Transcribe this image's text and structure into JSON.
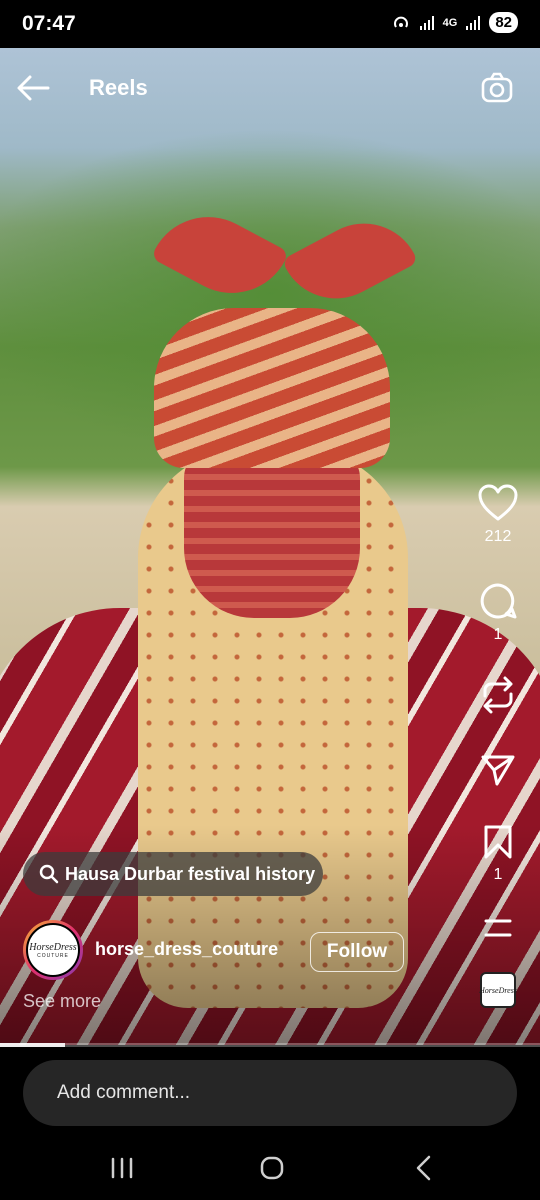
{
  "status_bar": {
    "time": "07:47",
    "network": "4G",
    "battery": "82"
  },
  "header": {
    "title": "Reels",
    "back_icon": "arrow-left-icon",
    "camera_icon": "camera-icon"
  },
  "actions": {
    "likes": "212",
    "comments": "1",
    "saves": "1",
    "icons": [
      "heart-icon",
      "comment-icon",
      "repost-icon",
      "send-icon",
      "bookmark-icon",
      "more-icon"
    ]
  },
  "topic": {
    "label": "Hausa Durbar festival history",
    "icon": "search-icon"
  },
  "account": {
    "username": "horse_dress_couture",
    "follow_label": "Follow",
    "avatar_brand": "HorseDress",
    "avatar_sub": "COUTURE",
    "audio_brand": "HorseDress"
  },
  "caption": {
    "see_more": "See more"
  },
  "playback": {
    "progress": 0.12
  },
  "comment_box": {
    "placeholder": "Add comment..."
  },
  "colors": {
    "background": "#000000",
    "input_bg": "#262626",
    "avatar_ring": "#e1306c"
  }
}
